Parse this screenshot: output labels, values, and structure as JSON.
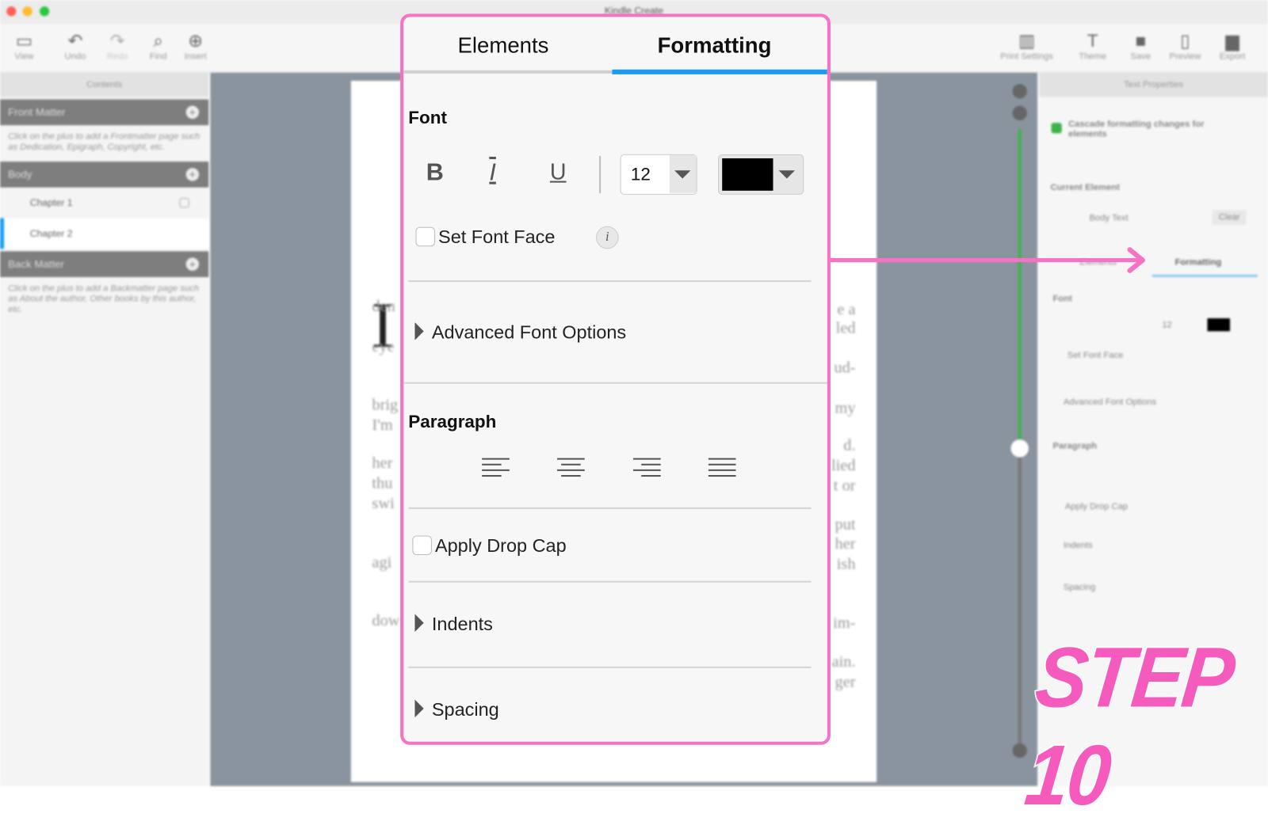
{
  "window": {
    "title": "Kindle Create"
  },
  "toolbar": {
    "left": [
      {
        "icon": "sidebar-view-icon",
        "label": "View"
      },
      {
        "icon": "undo-icon",
        "label": "Undo"
      },
      {
        "icon": "redo-icon",
        "label": "Redo"
      },
      {
        "icon": "search-icon",
        "label": "Find"
      },
      {
        "icon": "plus-circle-icon",
        "label": "Insert"
      }
    ],
    "right": [
      {
        "icon": "book-icon",
        "label": "Print Settings"
      },
      {
        "icon": "theme-icon",
        "label": "Theme"
      },
      {
        "icon": "save-icon",
        "label": "Save"
      },
      {
        "icon": "tablet-icon",
        "label": "Preview"
      },
      {
        "icon": "export-icon",
        "label": "Export"
      }
    ]
  },
  "sidebar": {
    "header": "Contents",
    "front_matter": {
      "label": "Front Matter",
      "hint": "Click on the plus to add a Frontmatter page such as Dedication, Epigraph, Copyright, etc."
    },
    "body": {
      "label": "Body",
      "chapters": [
        "Chapter 1",
        "Chapter 2"
      ]
    },
    "back_matter": {
      "label": "Back Matter",
      "hint": "Click on the plus to add a Backmatter page such as About the author, Other books by this author, etc."
    }
  },
  "document": {
    "drop_cap": "I",
    "left_fragments": [
      "den",
      "eye",
      "brig",
      "I'm",
      "her",
      "thu",
      "swi",
      "agi",
      "dow"
    ],
    "right_fragments": [
      "e a",
      "led",
      "ud-",
      "my",
      "d.",
      "lied",
      "t or",
      "put",
      "her",
      "ish",
      "im-",
      "ain.",
      "ger"
    ]
  },
  "right_panel": {
    "header": "Text Properties",
    "cascade_label": "Cascade formatting changes for elements",
    "cascade_checked": true,
    "current_element_label": "Current Element",
    "current_element_value": "Body Text",
    "clear_label": "Clear",
    "tabs": [
      "Elements",
      "Formatting"
    ],
    "font_label": "Font",
    "font_size": "12",
    "set_font_face": "Set Font Face",
    "advanced": "Advanced Font Options",
    "paragraph": "Paragraph",
    "drop_cap": "Apply Drop Cap",
    "indents": "Indents",
    "spacing": "Spacing"
  },
  "callout": {
    "tabs": {
      "elements": "Elements",
      "formatting": "Formatting",
      "active": "Formatting"
    },
    "font": {
      "heading": "Font",
      "bold": "B",
      "italic": "I",
      "underline": "U",
      "size": "12",
      "color": "#000000",
      "set_font_face": "Set Font Face",
      "set_font_face_checked": false,
      "info": "i"
    },
    "advanced_font_options": "Advanced Font Options",
    "paragraph": {
      "heading": "Paragraph",
      "alignments": [
        "align-left",
        "align-center",
        "align-right",
        "align-justify"
      ]
    },
    "apply_drop_cap": "Apply Drop Cap",
    "apply_drop_cap_checked": false,
    "indents": "Indents",
    "spacing": "Spacing"
  },
  "annotation": {
    "step": "STEP 10",
    "color": "#f771c5"
  },
  "colors": {
    "accent": "#1a9cf0",
    "highlight": "#f771c5",
    "progress": "#3cb44b"
  }
}
